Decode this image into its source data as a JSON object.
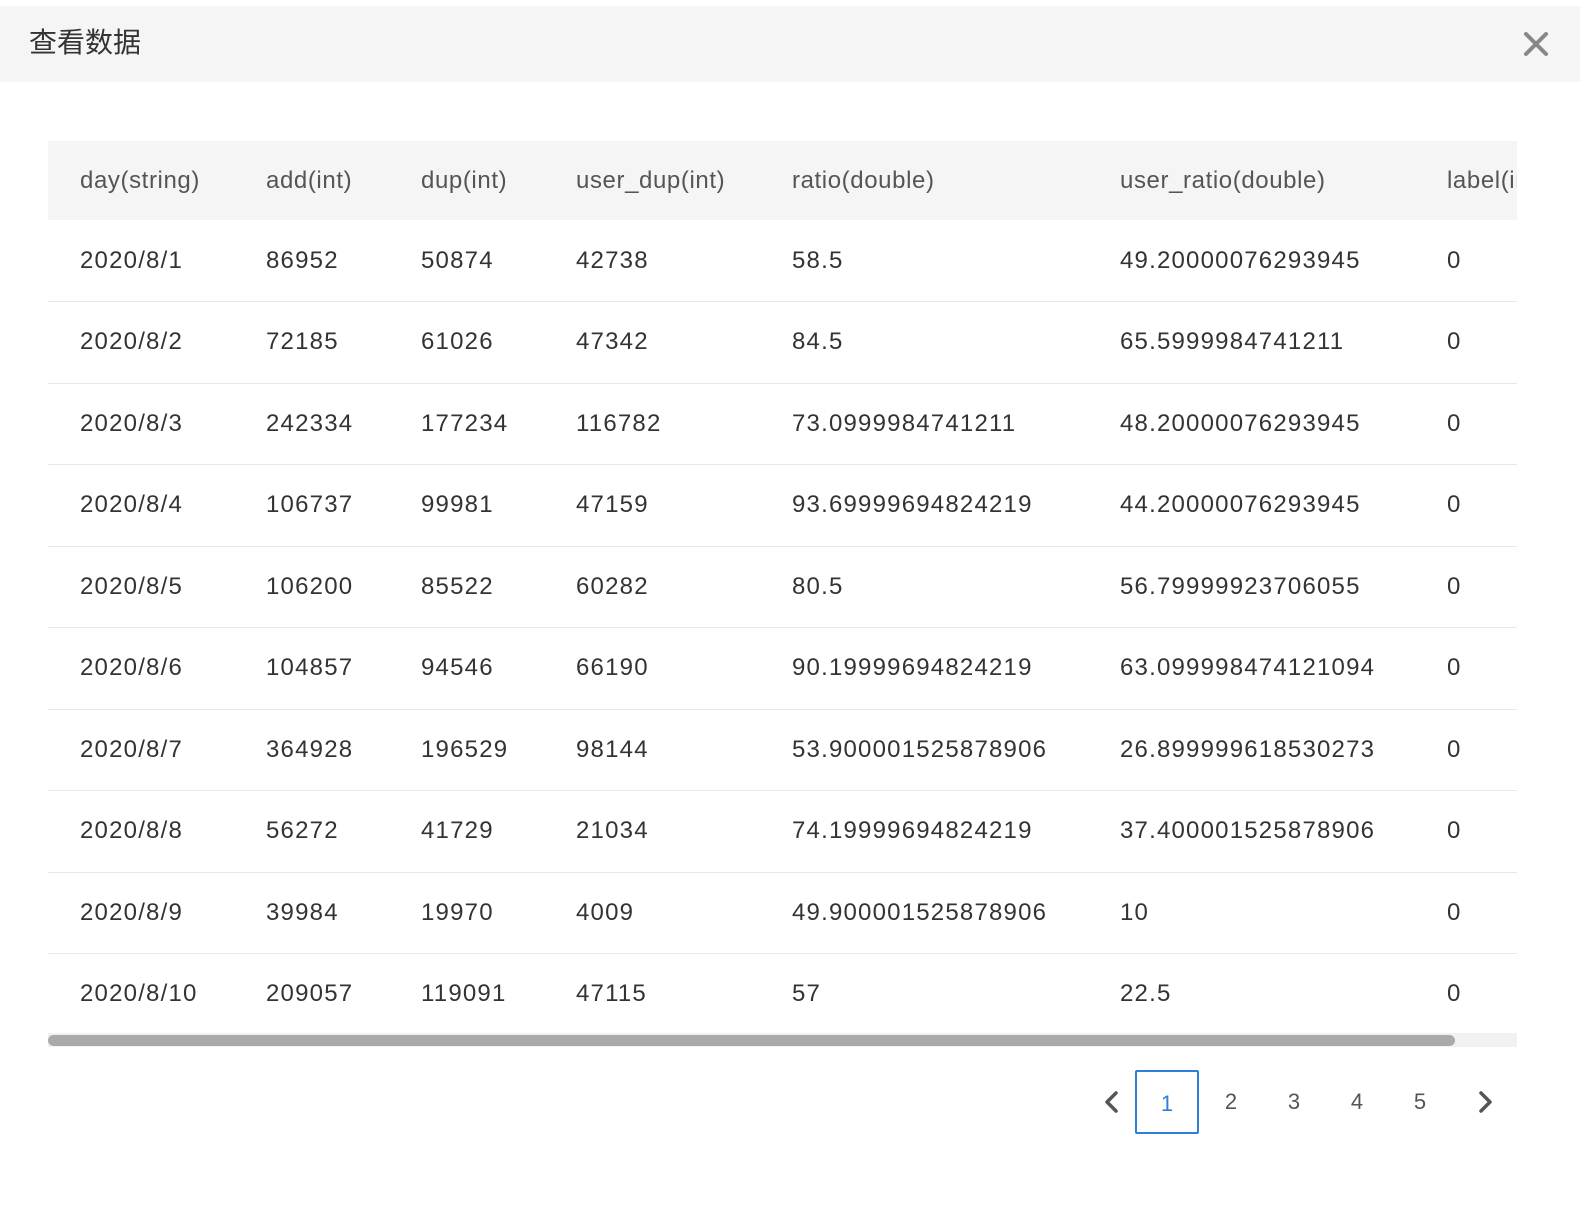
{
  "dialog": {
    "title": "查看数据",
    "close_icon": "close-icon"
  },
  "table": {
    "columns": [
      "day(string)",
      "add(int)",
      "dup(int)",
      "user_dup(int)",
      "ratio(double)",
      "user_ratio(double)",
      "label(int)"
    ],
    "rows": [
      [
        "2020/8/1",
        "86952",
        "50874",
        "42738",
        "58.5",
        "49.20000076293945",
        "0"
      ],
      [
        "2020/8/2",
        "72185",
        "61026",
        "47342",
        "84.5",
        "65.5999984741211",
        "0"
      ],
      [
        "2020/8/3",
        "242334",
        "177234",
        "116782",
        "73.0999984741211",
        "48.20000076293945",
        "0"
      ],
      [
        "2020/8/4",
        "106737",
        "99981",
        "47159",
        "93.69999694824219",
        "44.20000076293945",
        "0"
      ],
      [
        "2020/8/5",
        "106200",
        "85522",
        "60282",
        "80.5",
        "56.79999923706055",
        "0"
      ],
      [
        "2020/8/6",
        "104857",
        "94546",
        "66190",
        "90.19999694824219",
        "63.099998474121094",
        "0"
      ],
      [
        "2020/8/7",
        "364928",
        "196529",
        "98144",
        "53.900001525878906",
        "26.899999618530273",
        "0"
      ],
      [
        "2020/8/8",
        "56272",
        "41729",
        "21034",
        "74.19999694824219",
        "37.400001525878906",
        "0"
      ],
      [
        "2020/8/9",
        "39984",
        "19970",
        "4009",
        "49.900001525878906",
        "10",
        "0"
      ],
      [
        "2020/8/10",
        "209057",
        "119091",
        "47115",
        "57",
        "22.5",
        "0"
      ]
    ]
  },
  "pagination": {
    "pages": [
      "1",
      "2",
      "3",
      "4",
      "5"
    ],
    "current": "1",
    "prev_icon": "chevron-left-icon",
    "next_icon": "chevron-right-icon"
  },
  "colors": {
    "header_bg": "#f5f5f5",
    "accent": "#2d7fd8",
    "scroll_thumb": "#aaaaaa"
  }
}
